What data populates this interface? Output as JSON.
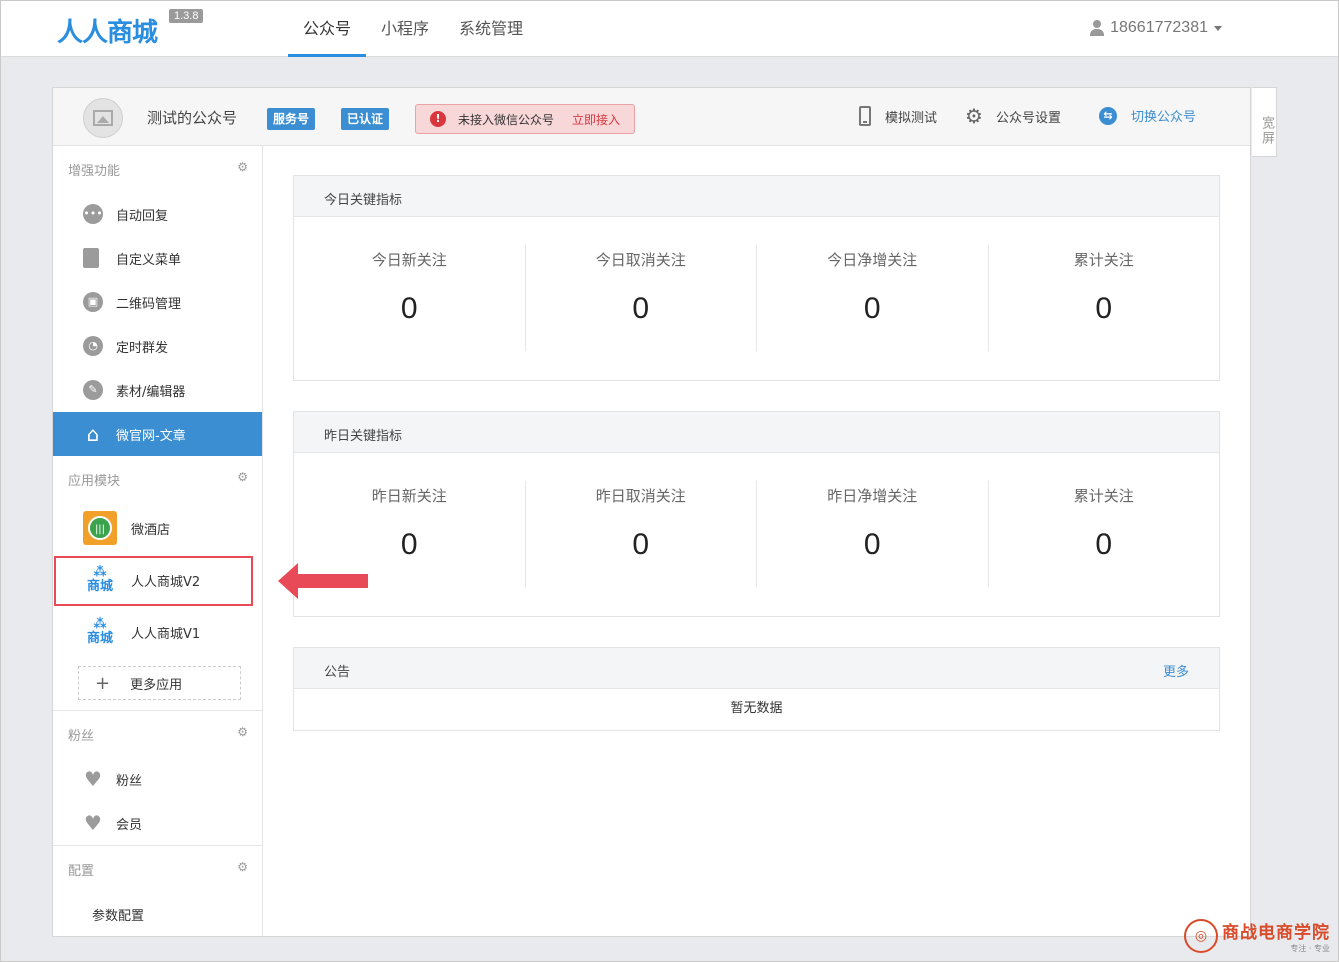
{
  "topnav": {
    "logo": "人人商城",
    "version": "1.3.8",
    "tabs": [
      {
        "label": "公众号",
        "active": true
      },
      {
        "label": "小程序",
        "active": false
      },
      {
        "label": "系统管理",
        "active": false
      }
    ],
    "user": "18661772381"
  },
  "header": {
    "account_name": "测试的公众号",
    "badge_service": "服务号",
    "badge_verified": "已认证",
    "alert_text": "未接入微信公众号",
    "alert_link": "立即接入",
    "actions": {
      "simulate": "模拟测试",
      "settings": "公众号设置",
      "switch": "切换公众号"
    },
    "wide_tab": "宽屏"
  },
  "sidebar": {
    "enhance_title": "增强功能",
    "enhance_items": [
      {
        "label": "自动回复",
        "icon": "chat-icon"
      },
      {
        "label": "自定义菜单",
        "icon": "document-icon"
      },
      {
        "label": "二维码管理",
        "icon": "qrcode-icon"
      },
      {
        "label": "定时群发",
        "icon": "clock-icon"
      },
      {
        "label": "素材/编辑器",
        "icon": "pencil-icon"
      },
      {
        "label": "微官网-文章",
        "icon": "home-icon",
        "active": true
      }
    ],
    "apps_title": "应用模块",
    "apps": [
      {
        "label": "微酒店",
        "icon": "hotel-app-icon"
      },
      {
        "label": "人人商城V2",
        "icon": "shop-app-icon",
        "highlighted": true
      },
      {
        "label": "人人商城V1",
        "icon": "shop-app-icon"
      }
    ],
    "more_apps": "更多应用",
    "fans_title": "粉丝",
    "fans_items": [
      {
        "label": "粉丝",
        "icon": "heart-icon"
      },
      {
        "label": "会员",
        "icon": "heart-icon"
      }
    ],
    "config_title": "配置",
    "config_items": [
      {
        "label": "参数配置"
      }
    ]
  },
  "today": {
    "title": "今日关键指标",
    "metrics": [
      {
        "label": "今日新关注",
        "value": "0"
      },
      {
        "label": "今日取消关注",
        "value": "0"
      },
      {
        "label": "今日净增关注",
        "value": "0"
      },
      {
        "label": "累计关注",
        "value": "0"
      }
    ]
  },
  "yesterday": {
    "title": "昨日关键指标",
    "metrics": [
      {
        "label": "昨日新关注",
        "value": "0"
      },
      {
        "label": "昨日取消关注",
        "value": "0"
      },
      {
        "label": "昨日净增关注",
        "value": "0"
      },
      {
        "label": "累计关注",
        "value": "0"
      }
    ]
  },
  "notice": {
    "title": "公告",
    "more": "更多",
    "empty": "暂无数据"
  },
  "watermark": {
    "title": "商战电商学院",
    "subtitle": "专注 · 专业"
  },
  "colors": {
    "accent": "#3b8ed2",
    "alert": "#d9363e",
    "highlight": "#e84a57"
  }
}
